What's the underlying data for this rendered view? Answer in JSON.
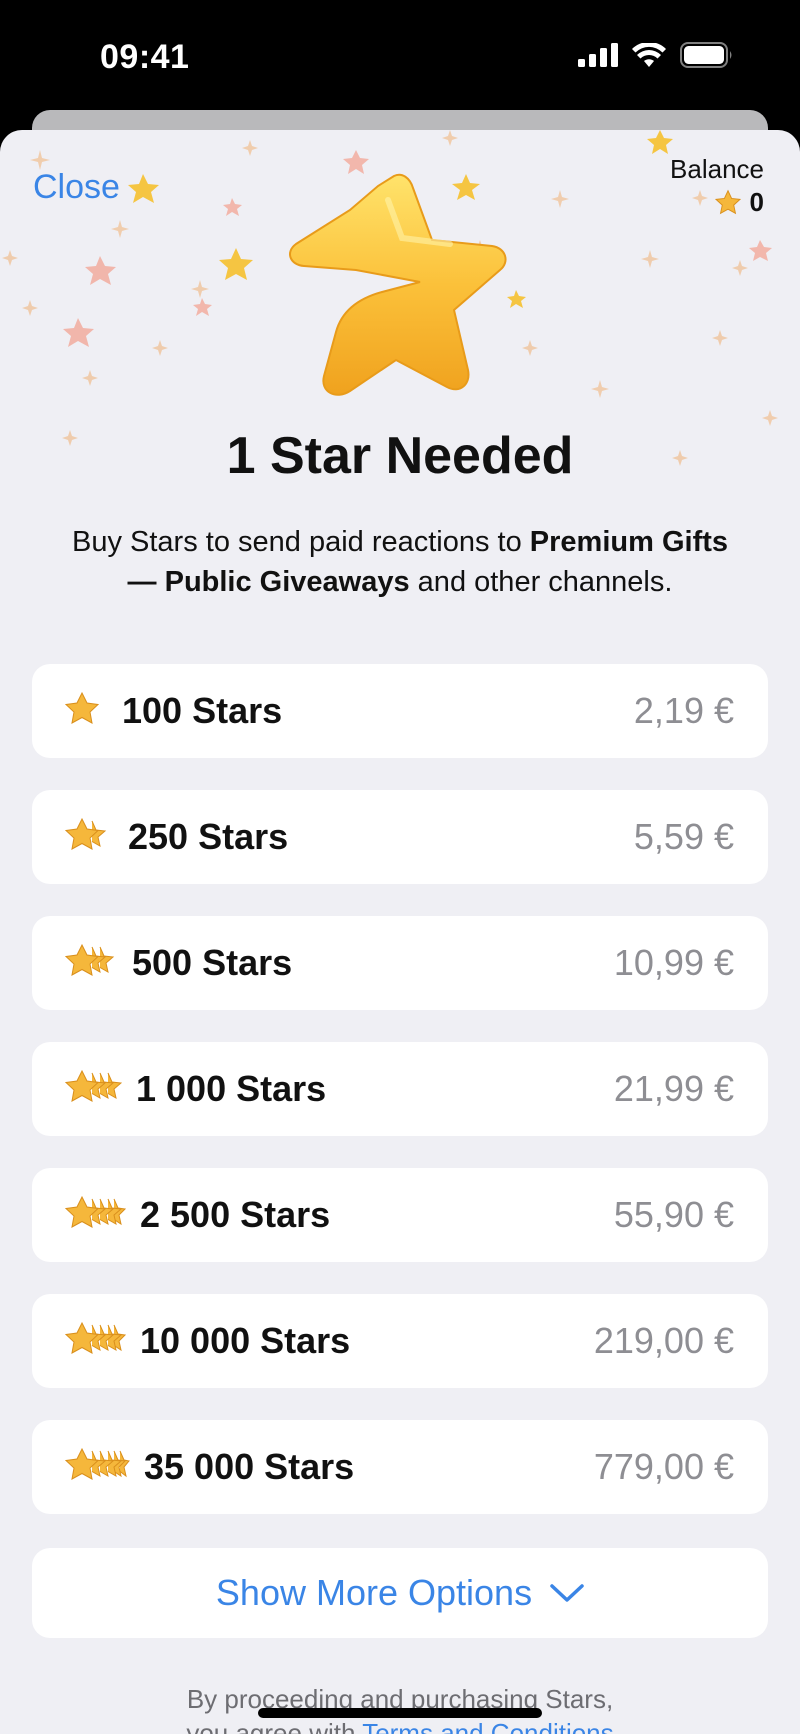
{
  "status_bar": {
    "time": "09:41"
  },
  "header": {
    "close_label": "Close",
    "balance_label": "Balance",
    "balance_value": "0"
  },
  "hero": {
    "title": "1 Star Needed",
    "subtitle_pre": "Buy Stars to send paid reactions to ",
    "subtitle_bold": "Premium Gifts — Public Giveaways",
    "subtitle_post": " and other channels."
  },
  "options": [
    {
      "label": "100 Stars",
      "price": "2,19 €"
    },
    {
      "label": "250 Stars",
      "price": "5,59 €"
    },
    {
      "label": "500 Stars",
      "price": "10,99 €"
    },
    {
      "label": "1 000 Stars",
      "price": "21,99 €"
    },
    {
      "label": "2 500 Stars",
      "price": "55,90 €"
    },
    {
      "label": "10 000 Stars",
      "price": "219,00 €"
    },
    {
      "label": "35 000 Stars",
      "price": "779,00 €"
    }
  ],
  "more_options_label": "Show More Options",
  "legal": {
    "line1": "By proceeding and purchasing Stars,",
    "line2_pre": "you agree with ",
    "terms_link": "Terms and Conditions"
  },
  "colors": {
    "accent": "#3a85e6",
    "star": "#f5b73b",
    "background": "#efeff4",
    "price": "#8e8e93"
  }
}
